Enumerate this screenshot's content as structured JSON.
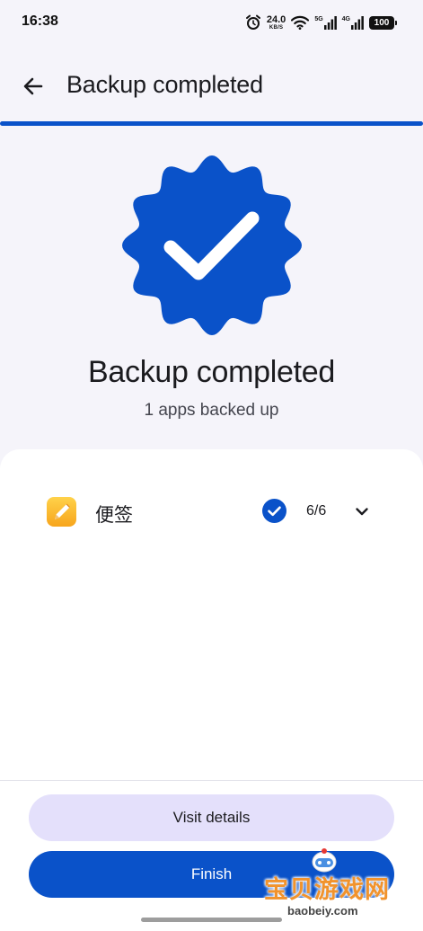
{
  "status_bar": {
    "time": "16:38",
    "net_speed_value": "24.0",
    "net_speed_unit": "KB/S",
    "signal1_tag": "5G",
    "signal2_tag": "4G",
    "battery": "100",
    "icons": [
      "alarm-icon",
      "wifi-icon",
      "signal-icon",
      "signal-icon",
      "battery-icon"
    ]
  },
  "app_bar": {
    "back_icon": "arrow-back-icon",
    "title": "Backup completed"
  },
  "progress": {
    "fraction": 1.0,
    "color": "#0a52c9"
  },
  "result": {
    "badge_icon": "verified-check-badge-icon",
    "title": "Backup completed",
    "subtitle": "1 apps backed up"
  },
  "apps": [
    {
      "icon": "notes-pencil-icon",
      "name": "便签",
      "status_icon": "check-circle-icon",
      "count": "6/6",
      "expand_icon": "chevron-down-icon"
    }
  ],
  "buttons": {
    "visit_details": "Visit details",
    "finish": "Finish"
  },
  "watermark": {
    "text": "宝贝游戏网",
    "url": "baobeiy.com"
  },
  "colors": {
    "accent": "#0a52c9",
    "secondary_button": "#e4e0fb",
    "background": "#f5f4fa"
  }
}
